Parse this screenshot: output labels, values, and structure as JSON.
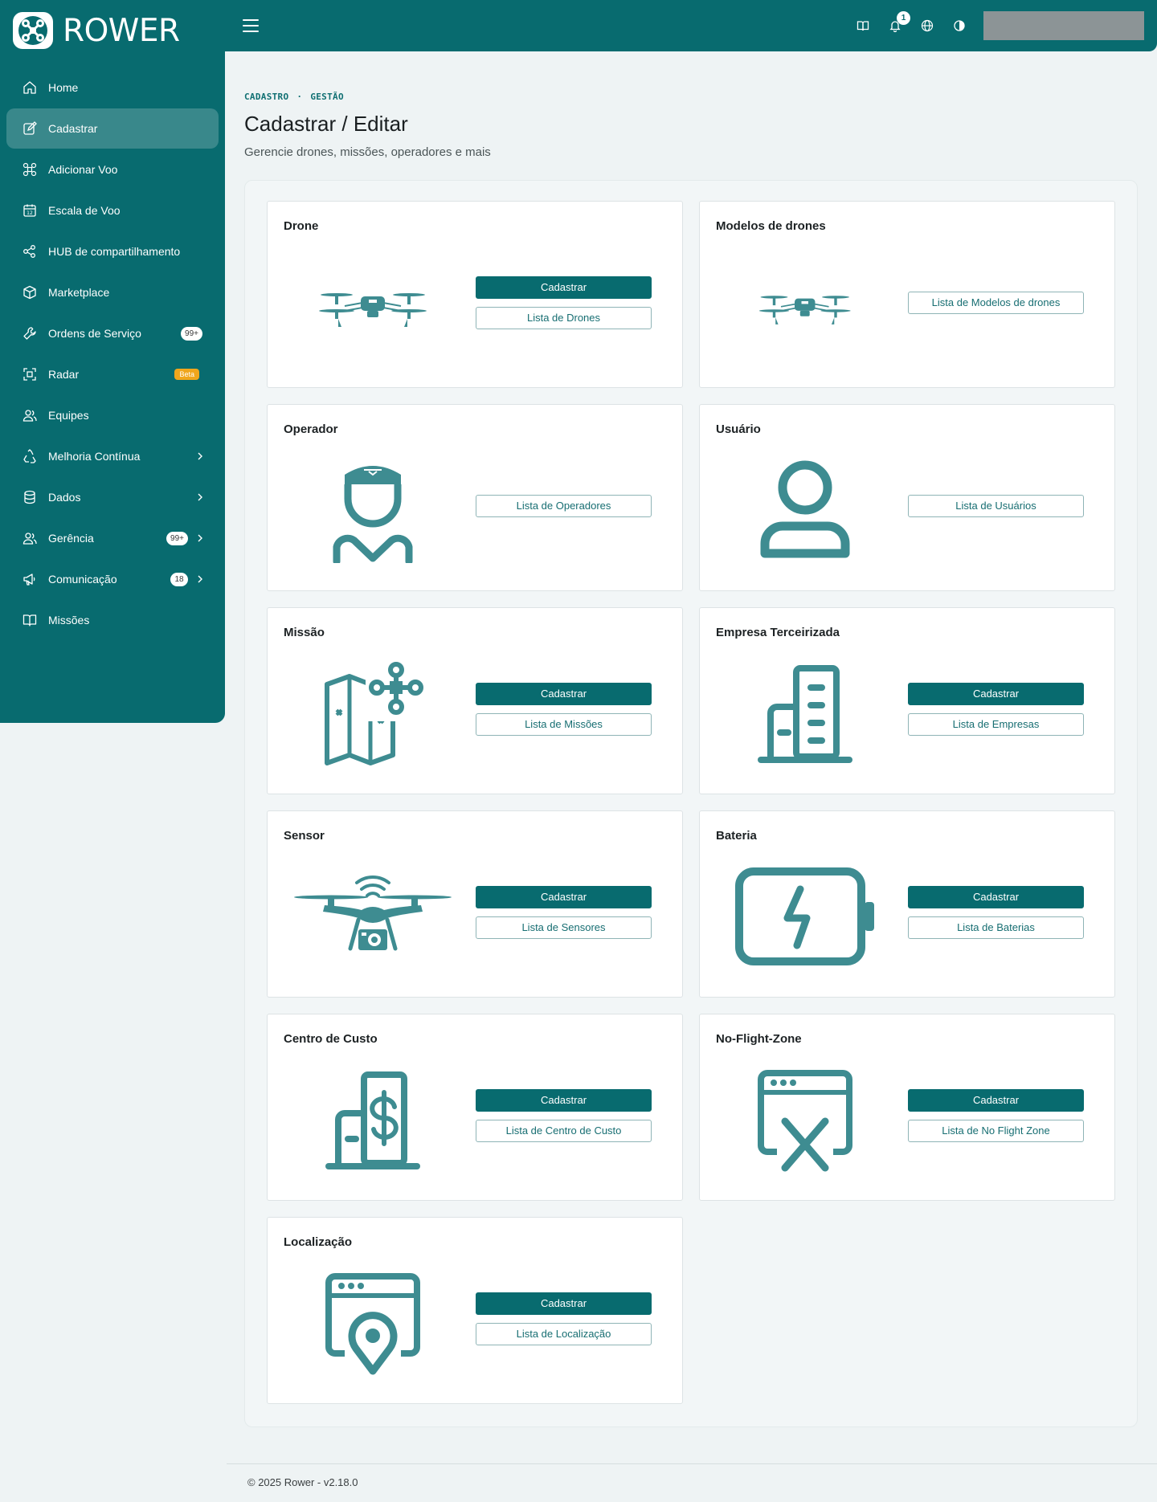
{
  "brand": {
    "name": "ROWER"
  },
  "sidebar": {
    "items": [
      {
        "label": "Home",
        "icon": "home-icon"
      },
      {
        "label": "Cadastrar",
        "icon": "edit-icon",
        "active": true
      },
      {
        "label": "Adicionar Voo",
        "icon": "drone-icon"
      },
      {
        "label": "Escala de Voo",
        "icon": "calendar-icon"
      },
      {
        "label": "HUB de compartilhamento",
        "icon": "share-icon"
      },
      {
        "label": "Marketplace",
        "icon": "box-icon"
      },
      {
        "label": "Ordens de Serviço",
        "icon": "wrench-icon",
        "badge": "99+"
      },
      {
        "label": "Radar",
        "icon": "radar-icon",
        "beta": "Beta"
      },
      {
        "label": "Equipes",
        "icon": "users-icon"
      },
      {
        "label": "Melhoria Contínua",
        "icon": "recycle-icon",
        "chevron": true
      },
      {
        "label": "Dados",
        "icon": "database-icon",
        "chevron": true
      },
      {
        "label": "Gerência",
        "icon": "users-icon",
        "badge": "99+",
        "chevron": true
      },
      {
        "label": "Comunicação",
        "icon": "megaphone-icon",
        "badge": "18",
        "chevron": true
      },
      {
        "label": "Missões",
        "icon": "book-icon"
      }
    ]
  },
  "topbar": {
    "notification_count": "1"
  },
  "breadcrumb": [
    "CADASTRO",
    "GESTÃO"
  ],
  "breadcrumb_sep": "·",
  "page": {
    "title": "Cadastrar / Editar",
    "subtitle": "Gerencie drones, missões, operadores e mais"
  },
  "cards": [
    {
      "title": "Drone",
      "icon": "drone-illustration",
      "primary": "Cadastrar",
      "secondary": "Lista de Drones"
    },
    {
      "title": "Modelos de drones",
      "icon": "drone-illustration",
      "primary": null,
      "secondary": "Lista de Modelos de drones"
    },
    {
      "title": "Operador",
      "icon": "pilot-illustration",
      "primary": null,
      "secondary": "Lista de Operadores"
    },
    {
      "title": "Usuário",
      "icon": "user-illustration",
      "primary": null,
      "secondary": "Lista de Usuários"
    },
    {
      "title": "Missão",
      "icon": "map-drone-illustration",
      "primary": "Cadastrar",
      "secondary": "Lista de Missões"
    },
    {
      "title": "Empresa Terceirizada",
      "icon": "building-illustration",
      "primary": "Cadastrar",
      "secondary": "Lista de Empresas"
    },
    {
      "title": "Sensor",
      "icon": "sensor-drone-illustration",
      "primary": "Cadastrar",
      "secondary": "Lista de Sensores"
    },
    {
      "title": "Bateria",
      "icon": "battery-illustration",
      "primary": "Cadastrar",
      "secondary": "Lista de Baterias"
    },
    {
      "title": "Centro de Custo",
      "icon": "cost-center-illustration",
      "primary": "Cadastrar",
      "secondary": "Lista de Centro de Custo"
    },
    {
      "title": "No-Flight-Zone",
      "icon": "no-flight-zone-illustration",
      "primary": "Cadastrar",
      "secondary": "Lista de No Flight Zone"
    },
    {
      "title": "Localização",
      "icon": "location-illustration",
      "primary": "Cadastrar",
      "secondary": "Lista de Localização"
    }
  ],
  "footer": {
    "text": "© 2025 Rower - v2.18.0"
  },
  "colors": {
    "primary": "#086b6f",
    "illustration": "#3e8c91",
    "beta": "#f0a61c"
  }
}
